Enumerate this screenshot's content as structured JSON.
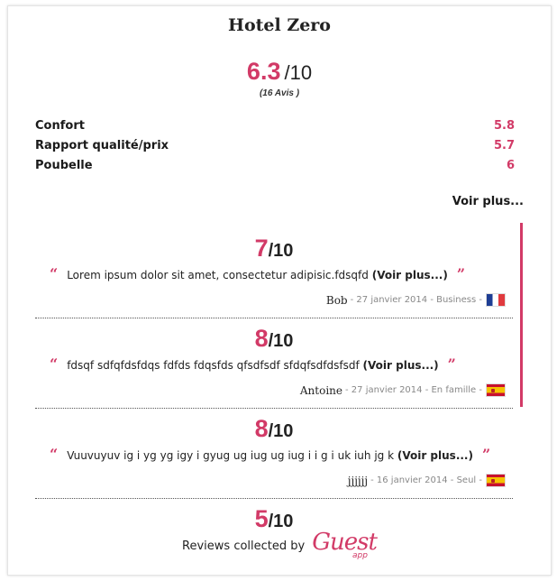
{
  "hotel": {
    "name": "Hotel Zero"
  },
  "overall": {
    "score": "6.3",
    "separator": "/",
    "out_of": "10",
    "count": "(16 Avis )"
  },
  "criteria": [
    {
      "label": "Confort",
      "value": "5.8"
    },
    {
      "label": "Rapport qualité/prix",
      "value": "5.7"
    },
    {
      "label": "Poubelle",
      "value": "6"
    }
  ],
  "voir_plus_label": "Voir plus...",
  "reviews": [
    {
      "score": "7",
      "out_of": "/10",
      "text": "Lorem ipsum dolor sit amet, consectetur adipisic.fdsqfd",
      "more": "(Voir plus...)",
      "author": "Bob",
      "detail": "- 27 janvier 2014 - Business -",
      "flag": "flag-france"
    },
    {
      "score": "8",
      "out_of": "/10",
      "text": "fdsqf sdfqfdsfdqs fdfds fdqsfds qfsdfsdf sfdqfsdfdsfsdf",
      "more": "(Voir plus...)",
      "author": "Antoine",
      "detail": "- 27 janvier 2014 - En famille -",
      "flag": "flag-spain"
    },
    {
      "score": "8",
      "out_of": "/10",
      "text": "Vuuvuyuv ig i yg yg igy i gyug ug iug ug iug i i g i uk iuh jg k",
      "more": "(Voir plus...)",
      "author": "jjjjjj",
      "detail": "- 16 janvier 2014 - Seul -",
      "flag": "flag-spain"
    },
    {
      "score": "5",
      "out_of": "/10"
    }
  ],
  "footer": {
    "collected_by": "Reviews collected by",
    "logo_main": "Guest",
    "logo_sub": "app"
  },
  "colors": {
    "accent": "#d23a67",
    "text": "#222222"
  }
}
